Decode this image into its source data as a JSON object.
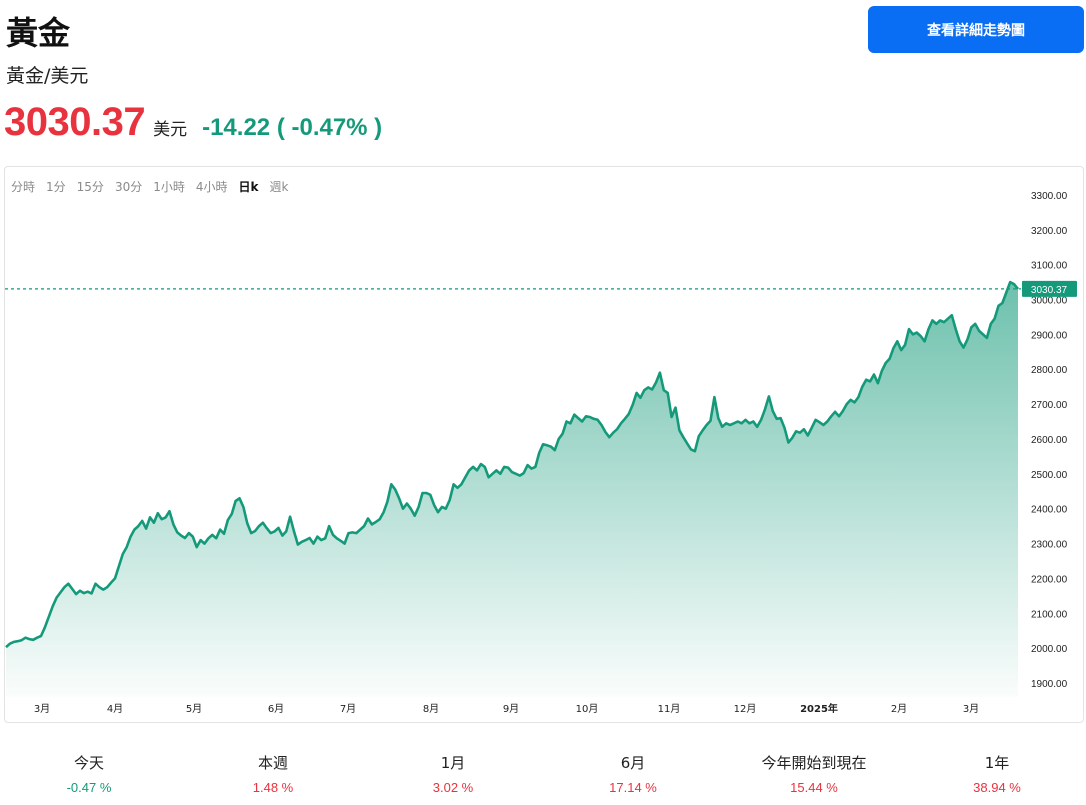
{
  "header": {
    "title": "黃金",
    "subtitle": "黃金/美元",
    "price": "3030.37",
    "unit": "美元",
    "change": "-14.22 ( -0.47% )",
    "detail_button": "查看詳細走勢圖"
  },
  "timeframes": [
    {
      "label": "分時",
      "active": false
    },
    {
      "label": "1分",
      "active": false
    },
    {
      "label": "15分",
      "active": false
    },
    {
      "label": "30分",
      "active": false
    },
    {
      "label": "1小時",
      "active": false
    },
    {
      "label": "4小時",
      "active": false
    },
    {
      "label": "日k",
      "active": true
    },
    {
      "label": "週k",
      "active": false
    }
  ],
  "chart_data": {
    "type": "area",
    "title": "",
    "xlabel": "",
    "ylabel": "",
    "ylim": [
      1860,
      3380
    ],
    "y_ticks": [
      "3300.00",
      "3200.00",
      "3100.00",
      "3000.00",
      "2900.00",
      "2800.00",
      "2700.00",
      "2600.00",
      "2500.00",
      "2400.00",
      "2300.00",
      "2200.00",
      "2100.00",
      "2000.00",
      "1900.00"
    ],
    "x_ticks": [
      {
        "label": "3月",
        "bold": false
      },
      {
        "label": "4月",
        "bold": false
      },
      {
        "label": "5月",
        "bold": false
      },
      {
        "label": "6月",
        "bold": false
      },
      {
        "label": "7月",
        "bold": false
      },
      {
        "label": "8月",
        "bold": false
      },
      {
        "label": "9月",
        "bold": false
      },
      {
        "label": "10月",
        "bold": false
      },
      {
        "label": "11月",
        "bold": false
      },
      {
        "label": "12月",
        "bold": false
      },
      {
        "label": "2025年",
        "bold": true
      },
      {
        "label": "2月",
        "bold": false
      },
      {
        "label": "3月",
        "bold": false
      }
    ],
    "last_value": 3030.37,
    "last_value_label": "3030.37",
    "series_color": "#149a7a",
    "series": [
      {
        "values": [
          2003,
          2013,
          2018,
          2020,
          2023,
          2030,
          2026,
          2024,
          2030,
          2035,
          2060,
          2090,
          2120,
          2145,
          2160,
          2175,
          2185,
          2170,
          2155,
          2165,
          2158,
          2162,
          2157,
          2185,
          2175,
          2168,
          2175,
          2188,
          2200,
          2235,
          2270,
          2290,
          2320,
          2340,
          2350,
          2365,
          2343,
          2375,
          2360,
          2387,
          2370,
          2375,
          2393,
          2355,
          2332,
          2323,
          2316,
          2330,
          2320,
          2290,
          2310,
          2300,
          2315,
          2325,
          2315,
          2340,
          2328,
          2368,
          2385,
          2422,
          2430,
          2405,
          2358,
          2330,
          2336,
          2350,
          2360,
          2344,
          2330,
          2335,
          2345,
          2323,
          2335,
          2377,
          2335,
          2297,
          2305,
          2310,
          2316,
          2300,
          2320,
          2310,
          2315,
          2350,
          2325,
          2315,
          2308,
          2300,
          2330,
          2332,
          2330,
          2340,
          2350,
          2372,
          2355,
          2362,
          2370,
          2390,
          2420,
          2470,
          2455,
          2430,
          2400,
          2415,
          2400,
          2380,
          2405,
          2445,
          2445,
          2440,
          2410,
          2390,
          2405,
          2400,
          2425,
          2470,
          2460,
          2470,
          2490,
          2510,
          2520,
          2510,
          2528,
          2520,
          2490,
          2500,
          2510,
          2500,
          2520,
          2518,
          2505,
          2500,
          2495,
          2502,
          2525,
          2515,
          2520,
          2560,
          2585,
          2582,
          2578,
          2568,
          2600,
          2615,
          2650,
          2645,
          2670,
          2660,
          2650,
          2665,
          2663,
          2658,
          2655,
          2640,
          2620,
          2605,
          2618,
          2628,
          2645,
          2658,
          2672,
          2698,
          2732,
          2718,
          2740,
          2748,
          2742,
          2762,
          2790,
          2740,
          2732,
          2663,
          2690,
          2625,
          2605,
          2587,
          2570,
          2565,
          2608,
          2625,
          2640,
          2652,
          2720,
          2660,
          2635,
          2645,
          2640,
          2645,
          2650,
          2645,
          2655,
          2645,
          2650,
          2635,
          2655,
          2685,
          2722,
          2680,
          2658,
          2660,
          2632,
          2590,
          2603,
          2622,
          2618,
          2628,
          2610,
          2632,
          2655,
          2648,
          2640,
          2650,
          2665,
          2678,
          2665,
          2680,
          2700,
          2712,
          2705,
          2720,
          2750,
          2770,
          2765,
          2785,
          2760,
          2795,
          2818,
          2830,
          2860,
          2880,
          2855,
          2870,
          2915,
          2900,
          2905,
          2895,
          2880,
          2915,
          2940,
          2930,
          2940,
          2935,
          2945,
          2955,
          2915,
          2880,
          2862,
          2885,
          2920,
          2930,
          2910,
          2900,
          2890,
          2930,
          2945,
          2982,
          2990,
          3020,
          3050,
          3044,
          3030
        ]
      }
    ]
  },
  "stats": [
    {
      "label": "今天",
      "value": "-0.47 %",
      "direction": "down"
    },
    {
      "label": "本週",
      "value": "1.48 %",
      "direction": "up"
    },
    {
      "label": "1月",
      "value": "3.02 %",
      "direction": "up"
    },
    {
      "label": "6月",
      "value": "17.14 %",
      "direction": "up"
    },
    {
      "label": "今年開始到現在",
      "value": "15.44 %",
      "direction": "up"
    },
    {
      "label": "1年",
      "value": "38.94 %",
      "direction": "up"
    }
  ]
}
